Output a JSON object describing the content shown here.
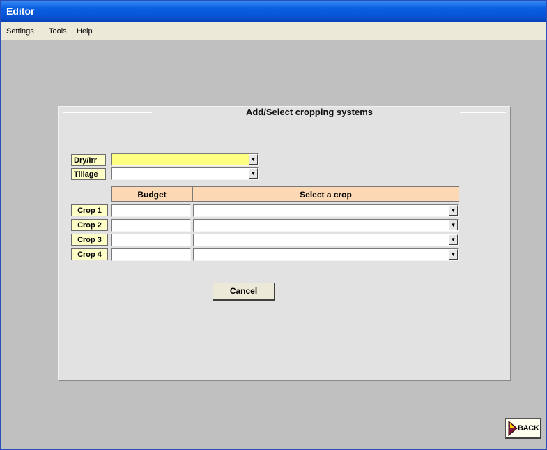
{
  "window": {
    "title": "Editor"
  },
  "menu": {
    "items": [
      "Settings",
      "Tools",
      "Help"
    ]
  },
  "panel": {
    "title": "Add/Select cropping systems"
  },
  "form": {
    "dry_irr": {
      "label": "Dry/Irr",
      "value": ""
    },
    "tillage": {
      "label": "Tillage",
      "value": ""
    },
    "columns": {
      "budget": "Budget",
      "crop": "Select a crop"
    },
    "crops": [
      {
        "label": "Crop 1",
        "budget": "",
        "crop": ""
      },
      {
        "label": "Crop 2",
        "budget": "",
        "crop": ""
      },
      {
        "label": "Crop 3",
        "budget": "",
        "crop": ""
      },
      {
        "label": "Crop 4",
        "budget": "",
        "crop": ""
      }
    ]
  },
  "buttons": {
    "cancel": "Cancel",
    "back": "BACK"
  },
  "colors": {
    "titlebar": "#0a5fe2",
    "field_highlight": "#ffff80",
    "label_bg": "#ffffc8",
    "header_bg": "#fcd8b4",
    "panel_bg": "#e2e2e2"
  }
}
